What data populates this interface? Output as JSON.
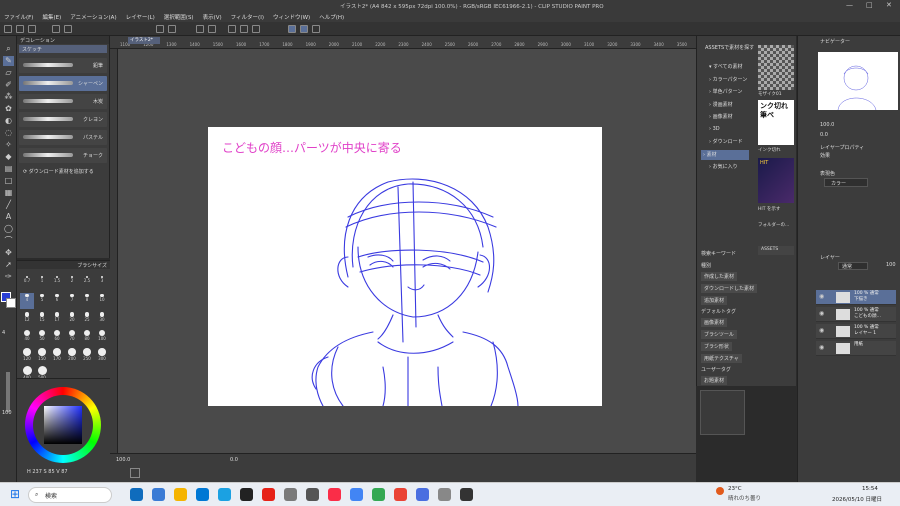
{
  "window": {
    "title": "イラスト2* (A4 842 x 595px 72dpi 100.0%) - RGB/sRGB IEC61966-2.1) - CLIP STUDIO PAINT PRO",
    "controls": [
      "—",
      "□",
      "✕"
    ]
  },
  "menu": [
    "ファイル(F)",
    "編集(E)",
    "アニメーション(A)",
    "レイヤー(L)",
    "選択範囲(S)",
    "表示(V)",
    "フィルター(I)",
    "ウィンドウ(W)",
    "ヘルプ(H)"
  ],
  "subtool_panel": {
    "tab": "デコレーション",
    "group": "スケッチ",
    "brushes": [
      {
        "name": "鉛筆",
        "selected": false
      },
      {
        "name": "シャーペン",
        "selected": true
      },
      {
        "name": "木炭",
        "selected": false
      },
      {
        "name": "クレヨン",
        "selected": false
      },
      {
        "name": "パステル",
        "selected": false
      },
      {
        "name": "チョーク",
        "selected": false
      }
    ],
    "download_label": "ダウンロード素材を追加する"
  },
  "brush_size": {
    "tab": "ブラシサイズ",
    "sizes": [
      "0.7",
      "1",
      "1.5",
      "2",
      "2.5",
      "3",
      "4",
      "5",
      "6",
      "7",
      "8",
      "10",
      "12",
      "15",
      "17",
      "20",
      "25",
      "30",
      "40",
      "50",
      "60",
      "70",
      "80",
      "100",
      "120",
      "150",
      "170",
      "200",
      "250",
      "300",
      "400",
      "500"
    ],
    "selected": "4",
    "opacity_value": "100"
  },
  "color": {
    "main": "#2a3fd6",
    "readout_h": "237",
    "readout_s": "85",
    "readout_v": "87"
  },
  "canvas": {
    "tab": "イラスト2*",
    "caption": "こどもの顔…パーツが中央に寄る",
    "caption_color": "#e040c8",
    "sketch_color": "#3a3ae0",
    "zoom": "100.0",
    "angle": "0.0"
  },
  "ruler_ticks": [
    "1100",
    "1200",
    "1300",
    "1400",
    "1500",
    "1600",
    "1700",
    "1800",
    "1900",
    "2000",
    "2100",
    "2200",
    "2300",
    "2400",
    "2500",
    "2600",
    "2700",
    "2800",
    "2900",
    "3000",
    "3100",
    "3200",
    "3300",
    "3400",
    "3500"
  ],
  "material_panel": {
    "header": "ASSETSで素材を探す",
    "tree": [
      "すべての素材",
      "カラーパターン",
      "単色パターン",
      "漫画素材",
      "画像素材",
      "3D",
      "ダウンロード",
      "素材",
      "お気に入り"
    ],
    "selected": "素材",
    "thumb_labels": [
      "モザイク01",
      "インク切れ",
      "HIT を示す",
      "フォルダーの..."
    ],
    "search_label": "検索キーワード",
    "tag_groups": [
      {
        "heading": "種別",
        "tags": [
          "作成した素材",
          "ダウンロードした素材",
          "追加素材"
        ]
      },
      {
        "heading": "デフォルトタグ",
        "tags": [
          "画像素材",
          "ブラシツール",
          "ブラシ形状",
          "用紙テクスチャ"
        ]
      },
      {
        "heading": "ユーザータグ",
        "tags": [
          "お題素材"
        ]
      }
    ],
    "assets_button": "ASSETS"
  },
  "navigator": {
    "tab": "ナビゲーター",
    "zoom": "100.0",
    "angle": "0.0"
  },
  "layer_property": {
    "tab": "レイヤープロパティ",
    "effect": "効果",
    "expression": "表現色",
    "expression_value": "カラー"
  },
  "layers": {
    "tab": "レイヤー",
    "blend": "通常",
    "opacity": "100",
    "rows": [
      {
        "name_top": "100 % 通常",
        "name_bottom": "下描き",
        "selected": true
      },
      {
        "name_top": "100 % 通常",
        "name_bottom": "こどもの顔…",
        "selected": false
      },
      {
        "name_top": "100 % 通常",
        "name_bottom": "レイヤー 1",
        "selected": false
      },
      {
        "name_top": "",
        "name_bottom": "用紙",
        "selected": false
      }
    ]
  },
  "taskbar": {
    "search_placeholder": "検索",
    "weather_temp": "23°C",
    "weather_text": "晴れのち曇り",
    "time": "15:54",
    "date": "2026/05/10 日曜日"
  }
}
